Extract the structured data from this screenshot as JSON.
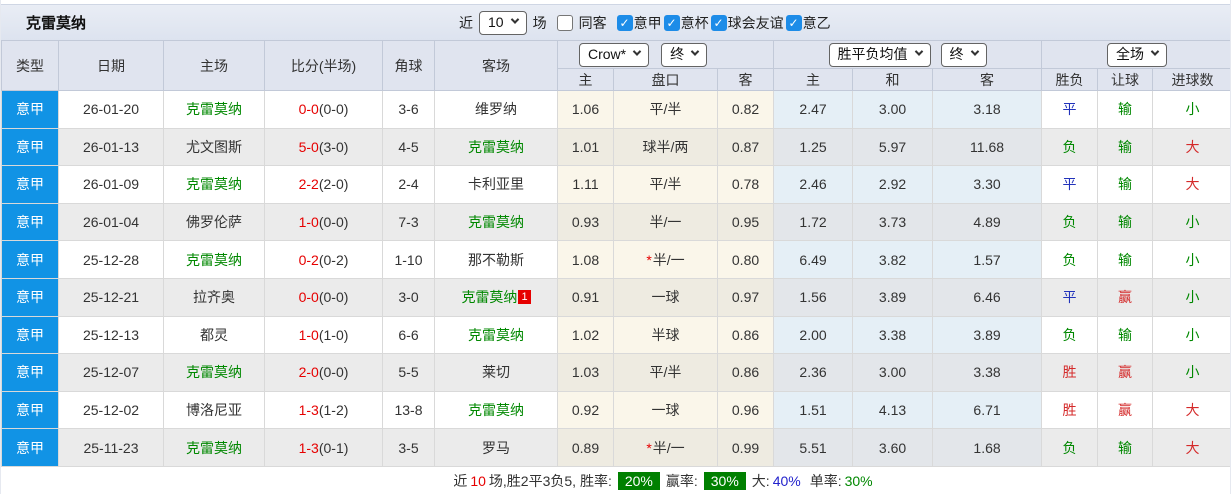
{
  "page": {
    "title": "克雷莫纳"
  },
  "topbar": {
    "recent_label": "近",
    "recent_value": "10",
    "games_label": "场",
    "same_away_label": "同客",
    "same_away_checked": false,
    "check_glyph": "✓",
    "leagues": [
      {
        "label": "意甲",
        "checked": true
      },
      {
        "label": "意杯",
        "checked": true
      },
      {
        "label": "球会友谊",
        "checked": true
      },
      {
        "label": "意乙",
        "checked": true
      }
    ]
  },
  "table": {
    "static_headers": [
      "类型",
      "日期",
      "主场",
      "比分(半场)",
      "角球",
      "客场"
    ],
    "group_controls": {
      "odds_source": "Crow*",
      "odds_time": "终",
      "avg_source": "胜平负均值",
      "avg_time": "终",
      "scope": "全场"
    },
    "sub_headers": [
      "主",
      "盘口",
      "客",
      "主",
      "和",
      "客",
      "胜负",
      "让球",
      "进球数"
    ],
    "rows": [
      {
        "league": "意甲",
        "date": "26-01-20",
        "home": "克雷莫纳",
        "home_target": true,
        "score": "0-0",
        "half_score": "(0-0)",
        "corners": "3-6",
        "away": "维罗纳",
        "away_target": false,
        "away_badge": "",
        "odds_home": "1.06",
        "handicap": "平/半",
        "handicap_star": false,
        "odds_away": "0.82",
        "avg_home": "2.47",
        "avg_draw": "3.00",
        "avg_away": "3.18",
        "res_outcome": {
          "text": "平",
          "color": "blue"
        },
        "res_handicap": {
          "text": "输",
          "color": "green"
        },
        "res_goals": {
          "text": "小",
          "color": "green"
        }
      },
      {
        "league": "意甲",
        "date": "26-01-13",
        "home": "尤文图斯",
        "home_target": false,
        "score": "5-0",
        "half_score": "(3-0)",
        "corners": "4-5",
        "away": "克雷莫纳",
        "away_target": true,
        "away_badge": "",
        "odds_home": "1.01",
        "handicap": "球半/两",
        "handicap_star": false,
        "odds_away": "0.87",
        "avg_home": "1.25",
        "avg_draw": "5.97",
        "avg_away": "11.68",
        "res_outcome": {
          "text": "负",
          "color": "green"
        },
        "res_handicap": {
          "text": "输",
          "color": "green"
        },
        "res_goals": {
          "text": "大",
          "color": "red"
        }
      },
      {
        "league": "意甲",
        "date": "26-01-09",
        "home": "克雷莫纳",
        "home_target": true,
        "score": "2-2",
        "half_score": "(2-0)",
        "corners": "2-4",
        "away": "卡利亚里",
        "away_target": false,
        "away_badge": "",
        "odds_home": "1.11",
        "handicap": "平/半",
        "handicap_star": false,
        "odds_away": "0.78",
        "avg_home": "2.46",
        "avg_draw": "2.92",
        "avg_away": "3.30",
        "res_outcome": {
          "text": "平",
          "color": "blue"
        },
        "res_handicap": {
          "text": "输",
          "color": "green"
        },
        "res_goals": {
          "text": "大",
          "color": "red"
        }
      },
      {
        "league": "意甲",
        "date": "26-01-04",
        "home": "佛罗伦萨",
        "home_target": false,
        "score": "1-0",
        "half_score": "(0-0)",
        "corners": "7-3",
        "away": "克雷莫纳",
        "away_target": true,
        "away_badge": "",
        "odds_home": "0.93",
        "handicap": "半/一",
        "handicap_star": false,
        "odds_away": "0.95",
        "avg_home": "1.72",
        "avg_draw": "3.73",
        "avg_away": "4.89",
        "res_outcome": {
          "text": "负",
          "color": "green"
        },
        "res_handicap": {
          "text": "输",
          "color": "green"
        },
        "res_goals": {
          "text": "小",
          "color": "green"
        }
      },
      {
        "league": "意甲",
        "date": "25-12-28",
        "home": "克雷莫纳",
        "home_target": true,
        "score": "0-2",
        "half_score": "(0-2)",
        "corners": "1-10",
        "away": "那不勒斯",
        "away_target": false,
        "away_badge": "",
        "odds_home": "1.08",
        "handicap": "半/一",
        "handicap_star": true,
        "odds_away": "0.80",
        "avg_home": "6.49",
        "avg_draw": "3.82",
        "avg_away": "1.57",
        "res_outcome": {
          "text": "负",
          "color": "green"
        },
        "res_handicap": {
          "text": "输",
          "color": "green"
        },
        "res_goals": {
          "text": "小",
          "color": "green"
        }
      },
      {
        "league": "意甲",
        "date": "25-12-21",
        "home": "拉齐奥",
        "home_target": false,
        "score": "0-0",
        "half_score": "(0-0)",
        "corners": "3-0",
        "away": "克雷莫纳",
        "away_target": true,
        "away_badge": "1",
        "odds_home": "0.91",
        "handicap": "一球",
        "handicap_star": false,
        "odds_away": "0.97",
        "avg_home": "1.56",
        "avg_draw": "3.89",
        "avg_away": "6.46",
        "res_outcome": {
          "text": "平",
          "color": "blue"
        },
        "res_handicap": {
          "text": "赢",
          "color": "red"
        },
        "res_goals": {
          "text": "小",
          "color": "green"
        }
      },
      {
        "league": "意甲",
        "date": "25-12-13",
        "home": "都灵",
        "home_target": false,
        "score": "1-0",
        "half_score": "(1-0)",
        "corners": "6-6",
        "away": "克雷莫纳",
        "away_target": true,
        "away_badge": "",
        "odds_home": "1.02",
        "handicap": "半球",
        "handicap_star": false,
        "odds_away": "0.86",
        "avg_home": "2.00",
        "avg_draw": "3.38",
        "avg_away": "3.89",
        "res_outcome": {
          "text": "负",
          "color": "green"
        },
        "res_handicap": {
          "text": "输",
          "color": "green"
        },
        "res_goals": {
          "text": "小",
          "color": "green"
        }
      },
      {
        "league": "意甲",
        "date": "25-12-07",
        "home": "克雷莫纳",
        "home_target": true,
        "score": "2-0",
        "half_score": "(0-0)",
        "corners": "5-5",
        "away": "莱切",
        "away_target": false,
        "away_badge": "",
        "odds_home": "1.03",
        "handicap": "平/半",
        "handicap_star": false,
        "odds_away": "0.86",
        "avg_home": "2.36",
        "avg_draw": "3.00",
        "avg_away": "3.38",
        "res_outcome": {
          "text": "胜",
          "color": "red"
        },
        "res_handicap": {
          "text": "赢",
          "color": "red"
        },
        "res_goals": {
          "text": "小",
          "color": "green"
        }
      },
      {
        "league": "意甲",
        "date": "25-12-02",
        "home": "博洛尼亚",
        "home_target": false,
        "score": "1-3",
        "half_score": "(1-2)",
        "corners": "13-8",
        "away": "克雷莫纳",
        "away_target": true,
        "away_badge": "",
        "odds_home": "0.92",
        "handicap": "一球",
        "handicap_star": false,
        "odds_away": "0.96",
        "avg_home": "1.51",
        "avg_draw": "4.13",
        "avg_away": "6.71",
        "res_outcome": {
          "text": "胜",
          "color": "red"
        },
        "res_handicap": {
          "text": "赢",
          "color": "red"
        },
        "res_goals": {
          "text": "大",
          "color": "red"
        }
      },
      {
        "league": "意甲",
        "date": "25-11-23",
        "home": "克雷莫纳",
        "home_target": true,
        "score": "1-3",
        "half_score": "(0-1)",
        "corners": "3-5",
        "away": "罗马",
        "away_target": false,
        "away_badge": "",
        "odds_home": "0.89",
        "handicap": "半/一",
        "handicap_star": true,
        "odds_away": "0.99",
        "avg_home": "5.51",
        "avg_draw": "3.60",
        "avg_away": "1.68",
        "res_outcome": {
          "text": "负",
          "color": "green"
        },
        "res_handicap": {
          "text": "输",
          "color": "green"
        },
        "res_goals": {
          "text": "大",
          "color": "red"
        }
      }
    ]
  },
  "footer": {
    "prefix": "近",
    "count": "10",
    "summary": "场,胜2平3负5, 胜率:",
    "win_rate": "20%",
    "odds_win_label": "赢率:",
    "odds_win_rate": "30%",
    "big_label": "大:",
    "big_rate": "40%",
    "single_label": "单率:",
    "single_rate": "30%"
  },
  "colors": {
    "league_cell_blue": "#1193e5",
    "target_team_green": "#008800",
    "score_red": "#e60000",
    "result_red": "#d42a2a",
    "result_blue": "#2233bb",
    "result_green": "#008800",
    "rate_badge_bg": "#008000",
    "checked_checkbox_blue": "#1d8ce8",
    "alt_row_gray": "#ebebeb",
    "handicap_col_cream": "#faf6ea",
    "avg_col_lightblue": "#e5eff6"
  }
}
